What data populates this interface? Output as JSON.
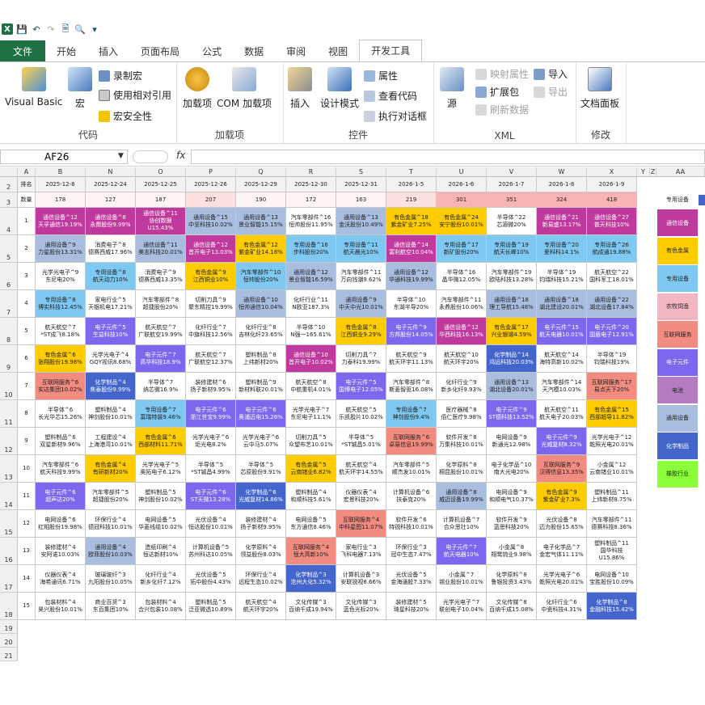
{
  "toolbar": {
    "excel_icon": "X",
    "save_icon": "save-icon",
    "undo_icon": "undo-icon",
    "redo_icon": "redo-icon",
    "new_icon": "new-icon",
    "preview_icon": "print-preview-icon",
    "customize_icon": "customize-icon"
  },
  "tabs": [
    "文件",
    "开始",
    "插入",
    "页面布局",
    "公式",
    "数据",
    "审阅",
    "视图",
    "开发工具"
  ],
  "active_tab": "开发工具",
  "ribbon": {
    "code": {
      "label": "代码",
      "visual_basic": "Visual Basic",
      "macro": "宏",
      "record": "录制宏",
      "relative": "使用相对引用",
      "security": "宏安全性"
    },
    "addins": {
      "label": "加载项",
      "addins": "加载项",
      "com": "COM 加载项"
    },
    "controls": {
      "label": "控件",
      "insert": "插入",
      "design": "设计模式",
      "properties": "属性",
      "view_code": "查看代码",
      "run_dialog": "执行对话框"
    },
    "xml": {
      "label": "XML",
      "source": "源",
      "map_props": "映射属性",
      "expansion": "扩展包",
      "refresh": "刷新数据",
      "import": "导入",
      "export": "导出"
    },
    "modify": {
      "label": "修改",
      "doc_panel": "文档面板"
    }
  },
  "formula_bar": {
    "name_box": "AF26",
    "fx": "fx",
    "formula": ""
  },
  "colors": {
    "通信设备": "#c0399d",
    "有色金属": "#ffcc00",
    "专用设备": "#7ec8f2",
    "农牧饲渔": "#f4b6c2",
    "互联网服务": "#f28b80",
    "电子元件": "#7b68ee",
    "电池": "#b67cc1",
    "通用设备": "#a9bedf",
    "化学制品": "#4466cc",
    "橡胶行业": "#8bff3a",
    "default": "#ffffff"
  },
  "col_letters": [
    "A",
    "B",
    "N",
    "O",
    "P",
    "Q",
    "R",
    "S",
    "T",
    "U",
    "V",
    "W",
    "X",
    "Y",
    "Z",
    "AA"
  ],
  "header_row": {
    "label": "排名",
    "dates": [
      "2025-12-8",
      "2025-12-24",
      "2025-12-25",
      "2025-12-26",
      "2025-12-29",
      "2025-12-30",
      "2025-12-31",
      "2026-1-5",
      "2026-1-6",
      "2026-1-7",
      "2026-1-8",
      "2026-1-9"
    ]
  },
  "count_row": {
    "label": "数量",
    "values": [
      "178",
      "127",
      "187",
      "207",
      "190",
      "172",
      "163",
      "219",
      "301",
      "351",
      "324",
      "418"
    ],
    "right_label": "专用设备"
  },
  "rows": [
    {
      "rank": "1",
      "cells": [
        [
          "通信设备^12",
          "天孚通信19.19%",
          "通信设备"
        ],
        [
          "通信设备^8",
          "永鼎股份9.99%",
          "通信设备"
        ],
        [
          "通信设备^11",
          "协创数据",
          "通信设备",
          "U15.43%"
        ],
        [
          "通用设备^15",
          "中坚科技10.02%",
          "通用设备"
        ],
        [
          "通用设备^13",
          "景业智能15.15%",
          "通用设备"
        ],
        [
          "汽车零部件^16",
          "恒帅股份11.95%",
          ""
        ],
        [
          "通用设备^13",
          "金沃股份10.49%",
          "通用设备"
        ],
        [
          "有色金属^18",
          "紫金矿业7.25%",
          "有色金属"
        ],
        [
          "有色金属^24",
          "安宁股份10.01%",
          "有色金属"
        ],
        [
          "半导体^22",
          "芯源微20%",
          ""
        ],
        [
          "通信设备^21",
          "新易盛13.17%",
          "通信设备"
        ],
        [
          "通信设备^27",
          "普天科技10%",
          "通信设备"
        ]
      ]
    },
    {
      "rank": "2",
      "cells": [
        [
          "通用设备^9",
          "力星股份13.31%",
          "通用设备"
        ],
        [
          "消费电子^8",
          "德赛西威17.96%",
          ""
        ],
        [
          "通信设备^11",
          "美志科技20.01%",
          "通用设备"
        ],
        [
          "通信设备^12",
          "首开电子13.03%",
          "通信设备"
        ],
        [
          "有色金属^12",
          "紫金矿业14.18%",
          "有色金属"
        ],
        [
          "专用设备^16",
          "步科股份20%",
          "专用设备"
        ],
        [
          "专用设备^11",
          "航天晨光10%",
          "专用设备"
        ],
        [
          "通信设备^14",
          "富利航空10.04%",
          "通信设备"
        ],
        [
          "专用设备^17",
          "新矿股份20%",
          "专用设备"
        ],
        [
          "专用设备^19",
          "航天长峰10%",
          "专用设备"
        ],
        [
          "专用设备^20",
          "爱科科14.1%",
          "专用设备"
        ],
        [
          "专用设备^26",
          "航成通19.88%",
          "专用设备"
        ]
      ]
    },
    {
      "rank": "3",
      "cells": [
        [
          "光学光电子^9",
          "东尼电20%",
          ""
        ],
        [
          "专用设备^8",
          "航天动力10%",
          "专用设备"
        ],
        [
          "消费电子^9",
          "德赛西威13.35%",
          ""
        ],
        [
          "有色金属^9",
          "江西铜业10%",
          "有色金属"
        ],
        [
          "汽车零部件^10",
          "恒帅股份20%",
          "专用设备"
        ],
        [
          "通用设备^12",
          "景业智能16.59%",
          "通用设备"
        ],
        [
          "汽车零部件^11",
          "万向钱潮9.62%",
          ""
        ],
        [
          "通用设备^12",
          "华通科技19.99%",
          "通用设备"
        ],
        [
          "半导体^16",
          "晶华微12.05%",
          ""
        ],
        [
          "汽车零部件^19",
          "欧陆科技13.28%",
          ""
        ],
        [
          "半导体^19",
          "钧瑞科技15.21%",
          ""
        ],
        [
          "航天航空^22",
          "国科军工18.01%",
          ""
        ]
      ]
    },
    {
      "rank": "4",
      "cells": [
        [
          "专用设备^8",
          "博实科技12.45%",
          "专用设备"
        ],
        [
          "家电行业^5",
          "天银机电17.21%",
          ""
        ],
        [
          "汽车零部件^8",
          "超捷股份20%",
          ""
        ],
        [
          "切削刀具^9",
          "聚东精控19.99%",
          ""
        ],
        [
          "通用设备^10",
          "恒帅通信10.04%",
          "通用设备"
        ],
        [
          "化纤行业^11",
          "N欧亚187.3%",
          ""
        ],
        [
          "通用设备^9",
          "中天中光10.01%",
          "通用设备"
        ],
        [
          "半导体^10",
          "东湖半导20%",
          ""
        ],
        [
          "汽车零部件^11",
          "永鼎股份10.06%",
          ""
        ],
        [
          "通用设备^18",
          "理工导航15.48%",
          "通用设备"
        ],
        [
          "通用设备^18",
          "湖北建设20.01%",
          "通用设备"
        ],
        [
          "通用设备^22",
          "湖北设备17.84%",
          "通用设备"
        ]
      ]
    },
    {
      "rank": "5",
      "cells": [
        [
          "航天航空^7",
          "*ST成飞8.18%",
          ""
        ],
        [
          "电子元件^5",
          "生益科技10%",
          "电子元件"
        ],
        [
          "航天航空^7",
          "广联航空19.99%",
          ""
        ],
        [
          "化纤行业^7",
          "中旗科技12.56%",
          ""
        ],
        [
          "化纤行业^8",
          "吉林化纤23.65%",
          ""
        ],
        [
          "半导体^10",
          "N强一165.61%",
          ""
        ],
        [
          "有色金属^8",
          "江西铜业9.29%",
          "有色金属"
        ],
        [
          "电子元件^9",
          "方邦股份14.05%",
          "电子元件"
        ],
        [
          "通信设备^12",
          "华西科技16.13%",
          "通信设备"
        ],
        [
          "有色金属^17",
          "兴业银锡4.59%",
          "有色金属"
        ],
        [
          "电子元件^15",
          "航天电器10.01%",
          "电子元件"
        ],
        [
          "电子元件^20",
          "国盾电子12.91%",
          "电子元件"
        ]
      ]
    },
    {
      "rank": "6",
      "cells": [
        [
          "有色金属^6",
          "张翔股份19.98%",
          "有色金属"
        ],
        [
          "光学光电子^4",
          "GQY视讯8.68%",
          ""
        ],
        [
          "电子元件^7",
          "高华科技18.9%",
          "电子元件"
        ],
        [
          "航天航空^7",
          "广联航空12.37%",
          ""
        ],
        [
          "塑料制品^8",
          "上纬新材20%",
          ""
        ],
        [
          "通信设备^10",
          "首开电子10.02%",
          "通信设备"
        ],
        [
          "切削刀具^7",
          "力泰科19.99%",
          ""
        ],
        [
          "航天航空^9",
          "航天环宇11.13%",
          ""
        ],
        [
          "航天航空^10",
          "航天环宇20%",
          ""
        ],
        [
          "化学制品^14",
          "鸿远科技20.03%",
          "化学制品"
        ],
        [
          "航天航空^14",
          "海特高新10.02%",
          ""
        ],
        [
          "半导体^19",
          "钧瑞科技19%",
          ""
        ]
      ]
    },
    {
      "rank": "7",
      "cells": [
        [
          "互联网服务^6",
          "实达集团10.02%",
          "互联网服务"
        ],
        [
          "化学制品^4",
          "焦泰股份9.99%",
          "化学制品"
        ],
        [
          "半导体^7",
          "纳芯微16.9%",
          ""
        ],
        [
          "装修建材^6",
          "扬子新材9.95%",
          ""
        ],
        [
          "塑料制品^9",
          "新材料联20.01%",
          ""
        ],
        [
          "航天航空^8",
          "中航重机4.01%",
          ""
        ],
        [
          "电子元件^5",
          "国博电子12.05%",
          "电子元件"
        ],
        [
          "汽车零部件^8",
          "斯菱智驱16.08%",
          ""
        ],
        [
          "化纤行业^9",
          "新乡化纤9.93%",
          ""
        ],
        [
          "通用设备^13",
          "湖北设备20.01%",
          "通用设备"
        ],
        [
          "汽车零部件^14",
          "天汽模10.03%",
          ""
        ],
        [
          "互联网服务^17",
          "易点天下20%",
          "互联网服务"
        ]
      ]
    },
    {
      "rank": "8",
      "cells": [
        [
          "半导体^6",
          "长光华芯15.26%",
          ""
        ],
        [
          "塑料制品^4",
          "神剑股份10.01%",
          ""
        ],
        [
          "专用设备^7",
          "富瑞特装9.46%",
          "专用设备"
        ],
        [
          "电子元件^6",
          "浙江世宝9.99%",
          "电子元件"
        ],
        [
          "电子元件^6",
          "奥浦迈电15.26%",
          "电子元件"
        ],
        [
          "光学光电子^7",
          "东尼电子11.1%",
          ""
        ],
        [
          "航天航空^5",
          "乐凯胶片10.02%",
          ""
        ],
        [
          "专用设备^7",
          "神剑股份9.4%",
          "专用设备"
        ],
        [
          "医疗器械^8",
          "佰仁医疗9.98%",
          ""
        ],
        [
          "电子元件^9",
          "ST德科技13.52%",
          "电子元件"
        ],
        [
          "航天航空^11",
          "航天电子20.03%",
          ""
        ],
        [
          "有色金属^15",
          "西部超导11.82%",
          "有色金属"
        ]
      ]
    },
    {
      "rank": "9",
      "cells": [
        [
          "塑料制品^6",
          "双星新材9.96%",
          ""
        ],
        [
          "工程建设^4",
          "上海港湾10.01%",
          ""
        ],
        [
          "有色金属^6",
          "西部材料11.71%",
          "有色金属"
        ],
        [
          "光学光电子^6",
          "炬光电8.2%",
          ""
        ],
        [
          "光学光电子^6",
          "云中马5.07%",
          ""
        ],
        [
          "切削刀具^5",
          "众望布艺10.01%",
          ""
        ],
        [
          "半导体^5",
          "*ST铖昌5.01%",
          ""
        ],
        [
          "互联网服务^6",
          "卓易信息19.99%",
          "互联网服务"
        ],
        [
          "软件开发^8",
          "万集科技10.01%",
          ""
        ],
        [
          "电网设备^9",
          "新通光12.98%",
          ""
        ],
        [
          "电子元件^9",
          "光威复材8.32%",
          "电子元件"
        ],
        [
          "光学光电子^12",
          "乾照光电20.01%",
          ""
        ]
      ]
    },
    {
      "rank": "10",
      "cells": [
        [
          "汽车零部件^6",
          "航天科技9.99%",
          ""
        ],
        [
          "有色金属^4",
          "有研新材20%",
          "有色金属"
        ],
        [
          "光学光电子^5",
          "奥拓电子6.12%",
          ""
        ],
        [
          "半导体^5",
          "*ST铖昌4.99%",
          ""
        ],
        [
          "半导体^5",
          "芯原股份9.91%",
          ""
        ],
        [
          "有色金属^5",
          "云南锗业6.82%",
          "有色金属"
        ],
        [
          "航天航空^4",
          "航天环宇14.55%",
          ""
        ],
        [
          "汽车零部件^5",
          "顺杰发10.01%",
          ""
        ],
        [
          "化学原料^8",
          "桐昆股份10.01%",
          ""
        ],
        [
          "电子化学品^10",
          "南大光电20%",
          ""
        ],
        [
          "互联网服务^9",
          "汉得信息13.35%",
          "互联网服务"
        ],
        [
          "小金属^12",
          "云南锗业10.01%",
          ""
        ]
      ]
    },
    {
      "rank": "11",
      "cells": [
        [
          "电子元件^6",
          "超声达20%",
          "电子元件"
        ],
        [
          "汽车零部件^5",
          "超捷股份20%",
          ""
        ],
        [
          "塑料制品^5",
          "神剑股份10.02%",
          ""
        ],
        [
          "电子元件^6",
          "ST天微13.28%",
          "电子元件"
        ],
        [
          "化学制品^6",
          "光威复材14.86%",
          "化学制品"
        ],
        [
          "塑料制品^4",
          "和顺科技5.61%",
          ""
        ],
        [
          "仪器仪表^4",
          "宏景科技20%",
          ""
        ],
        [
          "计算机设备^6",
          "扶泰克20%",
          ""
        ],
        [
          "通用设备^8",
          "威迈设备19.99%",
          "通用设备"
        ],
        [
          "电网设备^9",
          "和顺电气10.37%",
          ""
        ],
        [
          "有色金属^9",
          "紫金矿业7.3%",
          "有色金属"
        ],
        [
          "塑料制品^11",
          "上纬新材8.75%",
          ""
        ]
      ]
    },
    {
      "rank": "12",
      "cells": [
        [
          "电网设备^6",
          "红相股份19.98%",
          ""
        ],
        [
          "环保行业^4",
          "德冠科技10.01%",
          ""
        ],
        [
          "电网设备^5",
          "华菱线缆10.02%",
          ""
        ],
        [
          "光伏设备^4",
          "恒达股份10.01%",
          ""
        ],
        [
          "装修建材^4",
          "扬子新材9.95%",
          ""
        ],
        [
          "电网设备^5",
          "东方通信8.46%",
          ""
        ],
        [
          "互联网服务^4",
          "中科星图11.07%",
          "互联网服务"
        ],
        [
          "软件开发^6",
          "特锐科技10.01%",
          ""
        ],
        [
          "计算机设备^7",
          "合众思壮10%",
          ""
        ],
        [
          "软件开发^9",
          "蓝思科技20%",
          ""
        ],
        [
          "光伏设备^8",
          "迈为股份15.65%",
          ""
        ],
        [
          "汽车零部件^11",
          "德赛科技8.36%",
          ""
        ]
      ]
    },
    {
      "rank": "13",
      "cells": [
        [
          "装修建材^4",
          "安阿诺10.03%",
          ""
        ],
        [
          "通用设备^4",
          "欧菲股份10.03%",
          "通用设备"
        ],
        [
          "造纸印刷^4",
          "恒达新材10%",
          ""
        ],
        [
          "计算机设备^5",
          "苏州科达10.05%",
          ""
        ],
        [
          "化学原料^4",
          "领益股份8.03%",
          ""
        ],
        [
          "互联网服务^4",
          "恒大高新10%",
          "互联网服务"
        ],
        [
          "家电行业^3",
          "飞科电器7.13%",
          ""
        ],
        [
          "环保行业^3",
          "冠中生态7.47%",
          ""
        ],
        [
          "电子元件^7",
          "航天电器10%",
          "电子元件"
        ],
        [
          "小金属^8",
          "翔鹭钨业9.98%",
          ""
        ],
        [
          "电子化学品^7",
          "金宏气体11.11%",
          ""
        ],
        [
          "塑料制品^11",
          "国华科技",
          "",
          "U15.86%"
        ]
      ]
    },
    {
      "rank": "14",
      "cells": [
        [
          "仪器仪表^4",
          "海希通讯6.71%",
          ""
        ],
        [
          "玻璃玻纤^3",
          "九阳股份10.05%",
          ""
        ],
        [
          "化纤行业^4",
          "新乡化纤7.12%",
          ""
        ],
        [
          "光伏设备^5",
          "拓中股份4.43%",
          ""
        ],
        [
          "环保行业^4",
          "远程生态10.02%",
          ""
        ],
        [
          "化学制品^3",
          "沧州大化5.32%",
          "化学制品"
        ],
        [
          "计算机设备^3",
          "安联锐视8.66%",
          ""
        ],
        [
          "光伏设备^5",
          "金海通股7.33%",
          ""
        ],
        [
          "小金属^7",
          "锡业股份10.01%",
          ""
        ],
        [
          "化学原料^8",
          "鲁银投资3.43%",
          ""
        ],
        [
          "光学光电子^6",
          "乾照光电20.01%",
          ""
        ],
        [
          "电网设备^10",
          "宝胜股份10.09%",
          ""
        ]
      ]
    },
    {
      "rank": "15",
      "cells": [
        [
          "包装材料^4",
          "昊兴股份10.01%",
          ""
        ],
        [
          "商业百货^3",
          "东百集团10%",
          ""
        ],
        [
          "包装材料^4",
          "合兴包装10.08%",
          ""
        ],
        [
          "塑料制品^5",
          "泛亚微透10.89%",
          ""
        ],
        [
          "航天航空^4",
          "航天环宇20%",
          ""
        ],
        [
          "文化传媒^3",
          "百纳千成19.94%",
          ""
        ],
        [
          "文化传媒^3",
          "蓝色光标20%",
          ""
        ],
        [
          "装修建材^5",
          "琦星科技20%",
          ""
        ],
        [
          "光学光电子^7",
          "联创电子10.04%",
          ""
        ],
        [
          "文化传媒^8",
          "百纳千成15.08%",
          ""
        ],
        [
          "化纤行业^6",
          "中瓷科技4.31%",
          ""
        ],
        [
          "化学制品^8",
          "金融科技15.42%",
          "化学制品"
        ]
      ]
    }
  ],
  "blank_rows": [
    "19",
    "20",
    "21"
  ],
  "legend": [
    {
      "label": "通信设备",
      "key": "通信设备"
    },
    {
      "label": "有色金属",
      "key": "有色金属"
    },
    {
      "label": "专用设备",
      "key": "专用设备"
    },
    {
      "label": "农牧饲渔",
      "key": "农牧饲渔"
    },
    {
      "label": "互联网服务",
      "key": "互联网服务"
    },
    {
      "label": "电子元件",
      "key": "电子元件"
    },
    {
      "label": "电池",
      "key": "电池"
    },
    {
      "label": "通用设备",
      "key": "通用设备"
    },
    {
      "label": "化学制品",
      "key": "化学制品"
    },
    {
      "label": "橡胶行业",
      "key": "橡胶行业"
    }
  ]
}
